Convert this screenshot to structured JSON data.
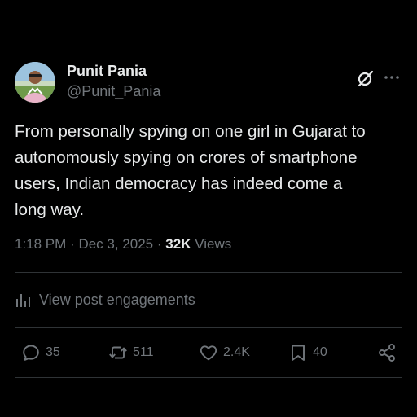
{
  "author": {
    "name": "Punit Pania",
    "handle": "@Punit_Pania"
  },
  "post": {
    "lines": [
      "From personally spying on one girl in Gujarat to",
      "autonomously spying on crores of smartphone",
      "users, Indian democracy has indeed come a",
      "long way."
    ],
    "time": "1:18 PM",
    "date": "Dec 3, 2025",
    "separator": "·",
    "views_count": "32K",
    "views_label": "Views"
  },
  "engagements_label": "View post engagements",
  "actions": {
    "replies": "35",
    "reposts": "511",
    "likes": "2.4K",
    "bookmarks": "40"
  },
  "icons": {
    "header": [
      "grok-icon",
      "more-icon"
    ],
    "engagements": "analytics-icon",
    "actions": [
      "reply-icon",
      "repost-icon",
      "like-icon",
      "bookmark-icon",
      "share-icon"
    ]
  },
  "colors": {
    "background": "#000000",
    "primary_text": "#e7e9ea",
    "secondary_text": "#71767b",
    "divider": "#2f3336"
  }
}
